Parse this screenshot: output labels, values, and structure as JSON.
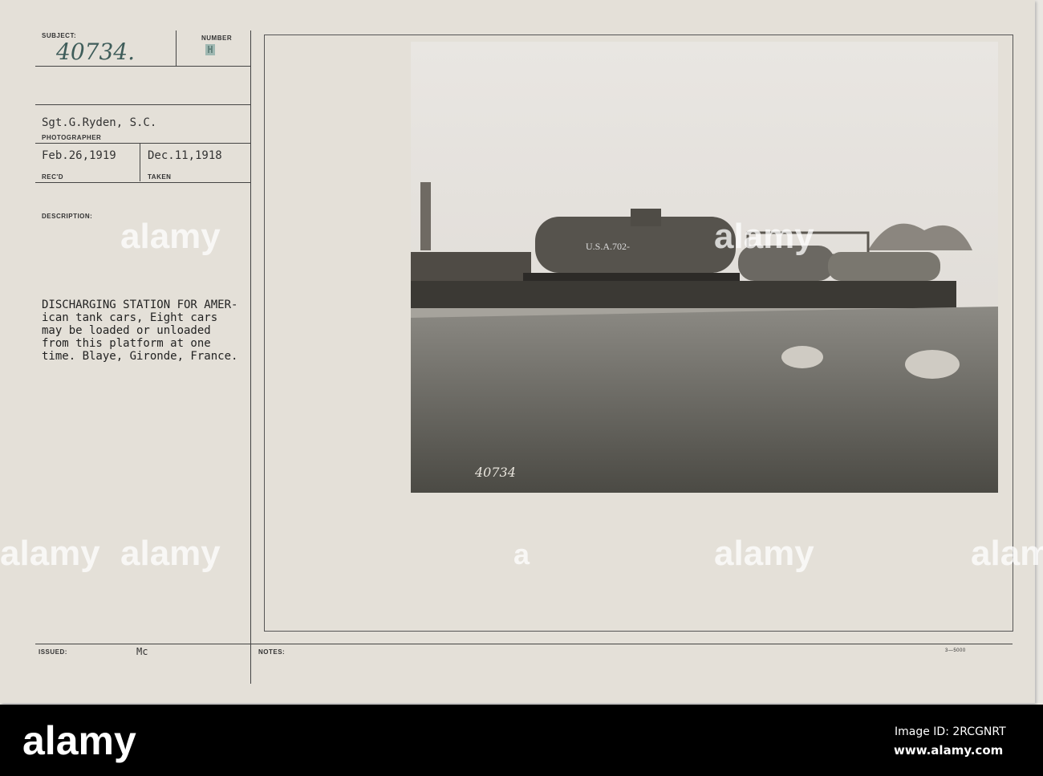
{
  "card": {
    "subject_label": "SUBJECT:",
    "subject_number": "40734.",
    "number_label": "NUMBER",
    "number_stamp": "H",
    "photographer": "Sgt.G.Ryden, S.C.",
    "photographer_label": "PHOTOGRAPHER",
    "received_date": "Feb.26,1919",
    "received_label": "REC'D",
    "taken_date": "Dec.11,1918",
    "taken_label": "TAKEN",
    "description_label": "DESCRIPTION:",
    "description": "DISCHARGING STATION FOR AMER-\nican tank cars, Eight cars\nmay be loaded or unloaded\nfrom this platform at one\ntime. Blaye, Gironde, France.",
    "issued_label": "ISSUED:",
    "issued_value": "Mc",
    "notes_label": "NOTES:",
    "form_number": "3—5000"
  },
  "photo": {
    "tank_marking": "U.S.A.702-",
    "photo_number": "40734"
  },
  "watermark": {
    "text": "alamy",
    "letter": "a"
  },
  "footer": {
    "logo": "alamy",
    "image_id": "Image ID: 2RCGNRT",
    "url": "www.alamy.com"
  }
}
